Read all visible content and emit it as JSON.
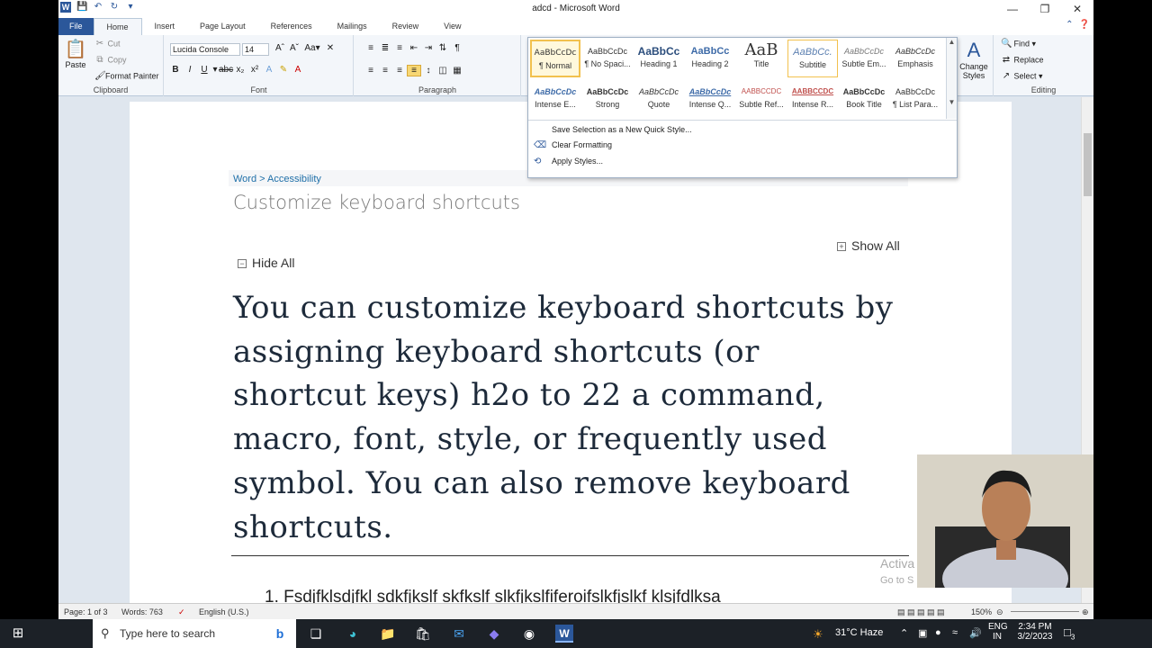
{
  "window": {
    "title": "adcd - Microsoft Word",
    "qat_icons": [
      "word-app-icon",
      "save-icon",
      "undo-icon",
      "redo-icon"
    ],
    "controls": [
      "minimize",
      "restore",
      "close"
    ]
  },
  "tabs": [
    {
      "label": "File"
    },
    {
      "label": "Home"
    },
    {
      "label": "Insert"
    },
    {
      "label": "Page Layout"
    },
    {
      "label": "References"
    },
    {
      "label": "Mailings"
    },
    {
      "label": "Review"
    },
    {
      "label": "View"
    }
  ],
  "ribbon": {
    "clipboard": {
      "label": "Clipboard",
      "paste": "Paste",
      "cut": "Cut",
      "copy": "Copy",
      "format_painter": "Format Painter"
    },
    "font": {
      "label": "Font",
      "font_name": "Lucida Console",
      "font_size": "14"
    },
    "paragraph": {
      "label": "Paragraph"
    },
    "styles": {
      "change_styles": "Change Styles"
    },
    "editing": {
      "label": "Editing",
      "find": "Find",
      "replace": "Replace",
      "select": "Select"
    }
  },
  "gallery": {
    "row1": [
      {
        "sample": "AaBbCcDc",
        "name": "¶ Normal"
      },
      {
        "sample": "AaBbCcDc",
        "name": "¶ No Spaci..."
      },
      {
        "sample": "AaBbCc",
        "name": "Heading 1"
      },
      {
        "sample": "AaBbCc",
        "name": "Heading 2"
      },
      {
        "sample": "AaB",
        "name": "Title"
      },
      {
        "sample": "AaBbCc.",
        "name": "Subtitle"
      },
      {
        "sample": "AaBbCcDc",
        "name": "Subtle Em..."
      },
      {
        "sample": "AaBbCcDc",
        "name": "Emphasis"
      }
    ],
    "row2": [
      {
        "sample": "AaBbCcDc",
        "name": "Intense E..."
      },
      {
        "sample": "AaBbCcDc",
        "name": "Strong"
      },
      {
        "sample": "AaBbCcDc",
        "name": "Quote"
      },
      {
        "sample": "AaBbCcDc",
        "name": "Intense Q..."
      },
      {
        "sample": "AABBCCDC",
        "name": "Subtle Ref..."
      },
      {
        "sample": "AABBCCDC",
        "name": "Intense R..."
      },
      {
        "sample": "AaBbCcDc",
        "name": "Book Title"
      },
      {
        "sample": "AaBbCcDc",
        "name": "¶ List Para..."
      }
    ],
    "menu": [
      {
        "label": "Save Selection as a New Quick Style...",
        "icon": ""
      },
      {
        "label": "Clear Formatting",
        "icon": "clear-formatting-icon"
      },
      {
        "label": "Apply Styles...",
        "icon": "apply-styles-icon"
      }
    ]
  },
  "document": {
    "breadcrumb": "Word > Accessibility",
    "title": "Customize keyboard shortcuts",
    "show_all": "Show All",
    "hide_all": "Hide All",
    "body_lines": [
      "You can customize keyboard shortcuts by",
      "assigning keyboard shortcuts (or",
      "shortcut keys)  h2o to 22 a command,",
      "macro, font, style, or frequently used",
      "symbol. You can also remove keyboard",
      "shortcuts."
    ],
    "list_item": "1.  Fsdjfklsdjfkl sdkfjkslf skfkslf slkfjkslfiferoifslkfjslkf klsjfdlksa",
    "watermark": "Activa",
    "watermark2": "Go to S"
  },
  "statusbar": {
    "page": "Page: 1 of 3",
    "words": "Words: 763",
    "language": "English (U.S.)",
    "zoom": "150%"
  },
  "taskbar": {
    "search_placeholder": "Type here to search",
    "weather": "31°C  Haze",
    "lang_top": "ENG",
    "lang_bottom": "IN",
    "time": "2:34 PM",
    "date": "3/2/2023",
    "notifications": "3"
  }
}
